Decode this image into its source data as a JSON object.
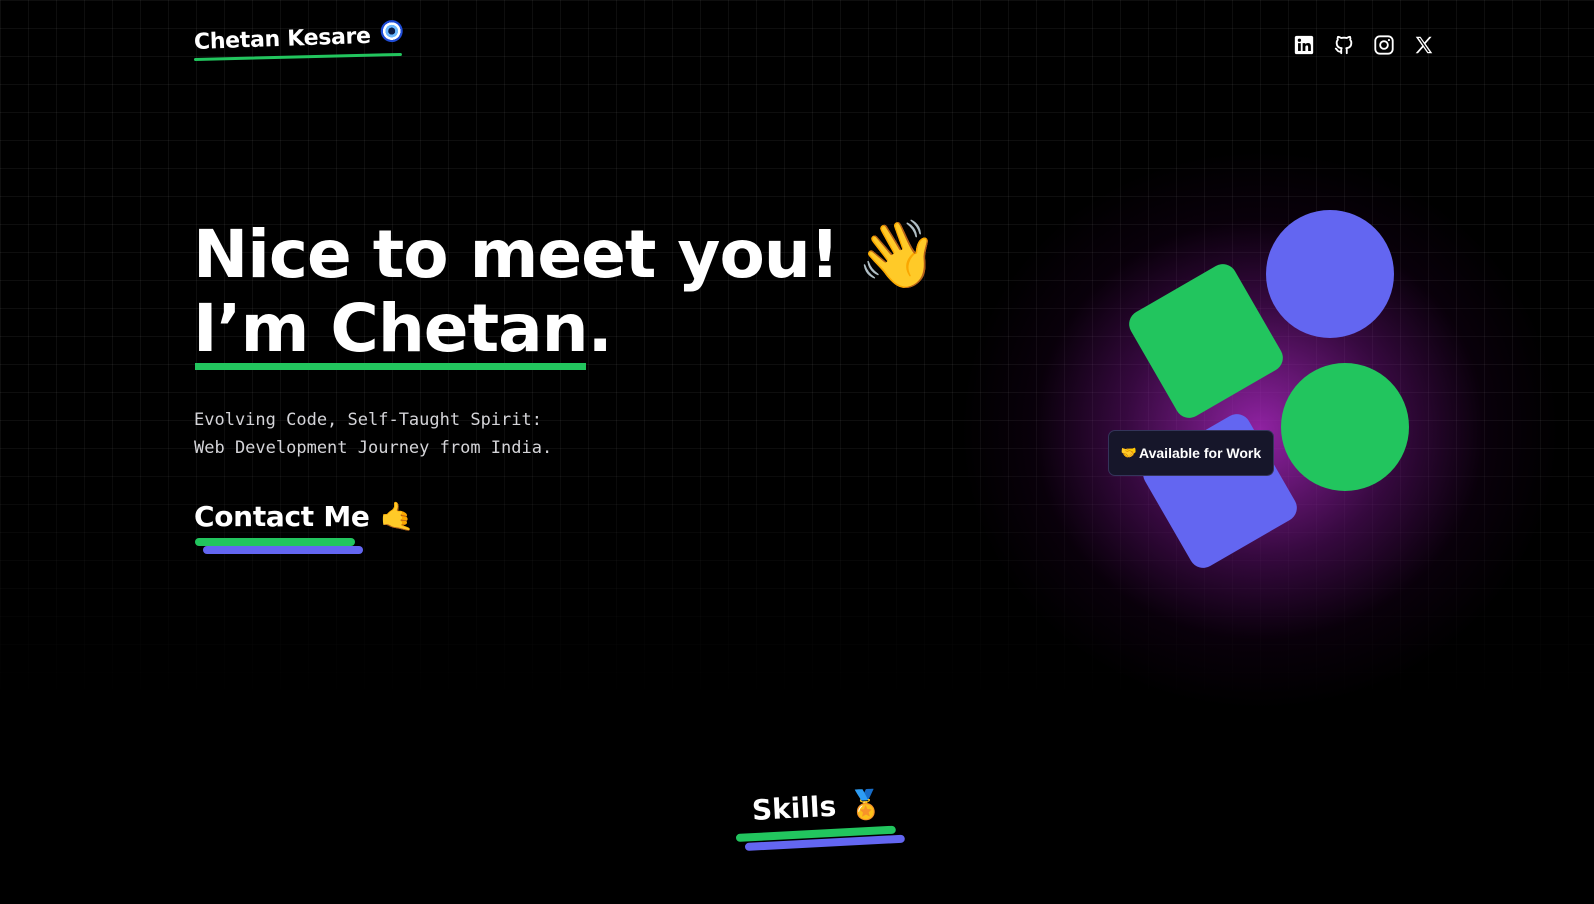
{
  "header": {
    "brand_name": "Chetan Kesare",
    "brand_icon": "nazar-eye-icon",
    "socials": [
      {
        "name": "linkedin",
        "icon": "linkedin-icon"
      },
      {
        "name": "github",
        "icon": "github-icon"
      },
      {
        "name": "instagram",
        "icon": "instagram-icon"
      },
      {
        "name": "x",
        "icon": "x-icon"
      }
    ]
  },
  "hero": {
    "line1": "Nice to meet you!",
    "wave_emoji": "👋",
    "line2": "I’m Chetan.",
    "subtitle": "Evolving Code, Self-Taught Spirit: Web Development Journey from India.",
    "contact_label": "Contact Me",
    "contact_emoji": "🤙",
    "badge_emoji": "🤝",
    "badge_label": "Available for Work"
  },
  "skills": {
    "title": "Skills",
    "emoji": "🏅"
  },
  "colors": {
    "background": "#000000",
    "accent_green": "#22c55e",
    "accent_indigo": "#6366f1",
    "glow_purple": "#a828be",
    "text_muted": "#d4d4d8"
  }
}
